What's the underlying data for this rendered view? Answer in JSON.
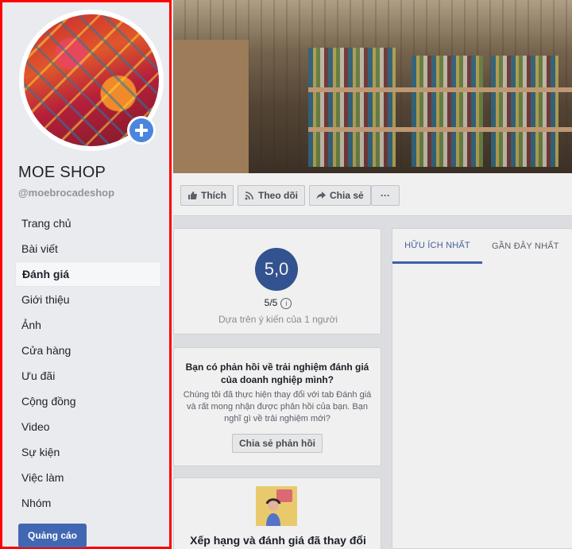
{
  "sidebar": {
    "shop_name": "MOE SHOP",
    "handle": "@moebrocadeshop",
    "nav_items": [
      {
        "label": "Trang chủ"
      },
      {
        "label": "Bài viết"
      },
      {
        "label": "Đánh giá",
        "active": true
      },
      {
        "label": "Giới thiệu"
      },
      {
        "label": "Ảnh"
      },
      {
        "label": "Cửa hàng"
      },
      {
        "label": "Ưu đãi"
      },
      {
        "label": "Cộng đồng"
      },
      {
        "label": "Video"
      },
      {
        "label": "Sự kiện"
      },
      {
        "label": "Việc làm"
      },
      {
        "label": "Nhóm"
      }
    ],
    "ads_button": "Quảng cáo",
    "highlight_color": "#ff0000"
  },
  "actions": {
    "like": "Thích",
    "follow": "Theo dõi",
    "share": "Chia sẻ",
    "more": "···"
  },
  "rating": {
    "score": "5,0",
    "out_of": "5/5",
    "info": "i",
    "based_on": "Dựa trên ý kiến của 1 người"
  },
  "feedback": {
    "title": "Bạn có phản hồi về trải nghiệm đánh giá của doanh nghiệp mình?",
    "body": "Chúng tôi đã thực hiện thay đổi với tab Đánh giá và rất mong nhận được phản hồi của bạn. Bạn nghĩ gì về trải nghiệm mới?",
    "button": "Chia sẻ phản hồi"
  },
  "promo": {
    "title": "Xếp hạng và đánh giá đã thay đổi"
  },
  "review_tabs": [
    {
      "label": "HỮU ÍCH NHẤT",
      "active": true
    },
    {
      "label": "GẦN ĐÂY NHẤT",
      "active": false
    }
  ],
  "colors": {
    "brand_blue": "#4267b2",
    "score_blue": "#365899",
    "page_bg": "#e9ebee"
  }
}
